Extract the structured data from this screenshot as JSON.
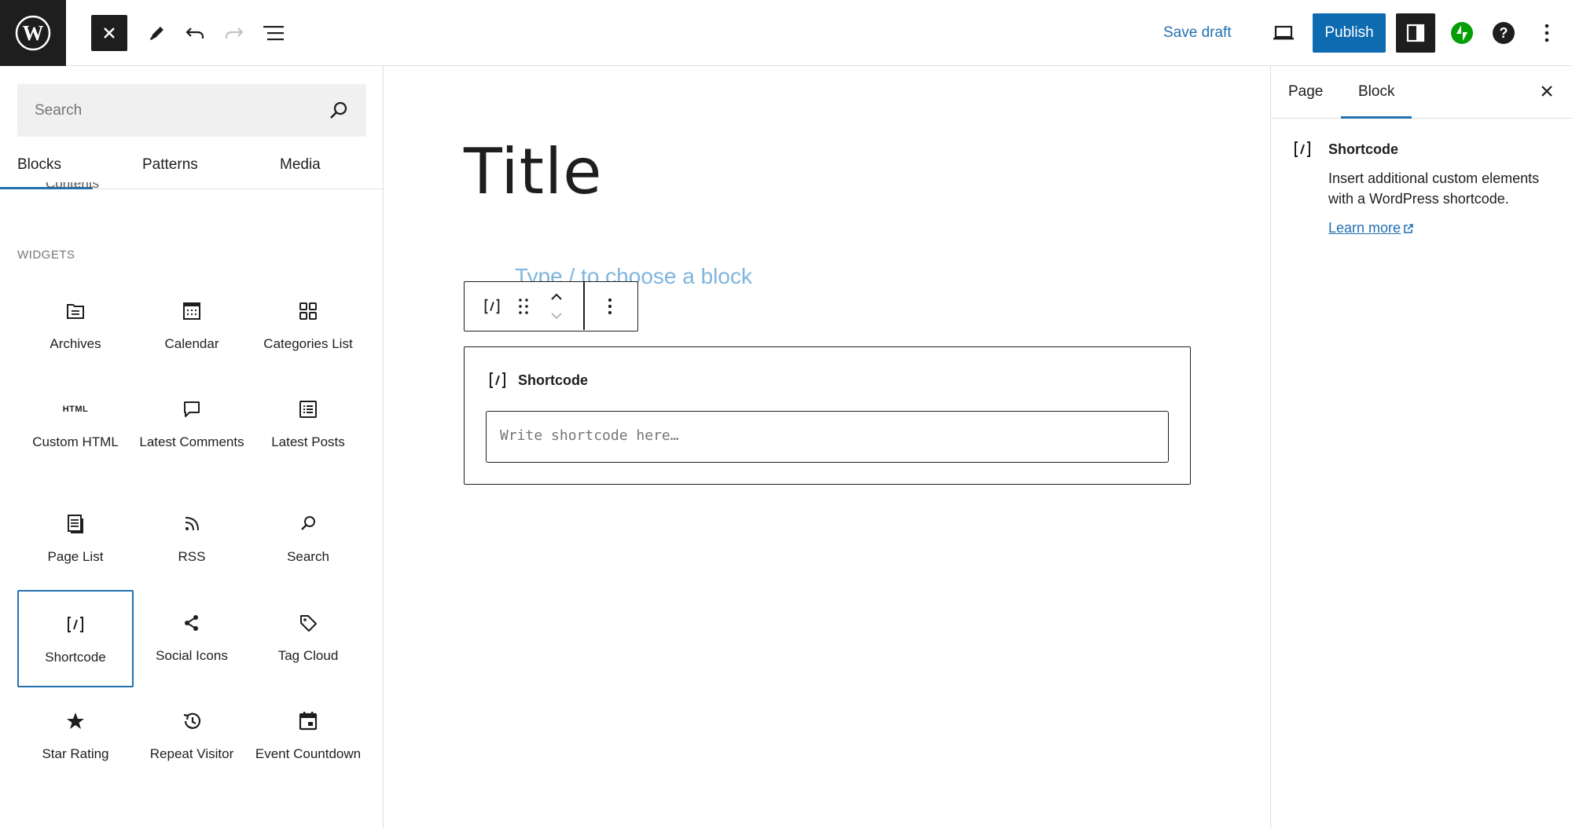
{
  "topbar": {
    "save_draft_label": "Save draft",
    "publish_label": "Publish"
  },
  "inserter": {
    "search_placeholder": "Search",
    "tabs": [
      {
        "label": "Blocks",
        "active": true
      },
      {
        "label": "Patterns",
        "active": false
      },
      {
        "label": "Media",
        "active": false
      }
    ],
    "cut_off_label": "Contents",
    "section_label": "WIDGETS",
    "items": [
      {
        "label": "Archives",
        "icon": "archive-icon"
      },
      {
        "label": "Calendar",
        "icon": "calendar-icon"
      },
      {
        "label": "Categories List",
        "icon": "categories-icon"
      },
      {
        "label": "Custom HTML",
        "icon": "html-icon",
        "icon_text": "HTML"
      },
      {
        "label": "Latest Comments",
        "icon": "comment-icon"
      },
      {
        "label": "Latest Posts",
        "icon": "latest-posts-icon"
      },
      {
        "label": "Page List",
        "icon": "page-list-icon"
      },
      {
        "label": "RSS",
        "icon": "rss-icon"
      },
      {
        "label": "Search",
        "icon": "search-icon"
      },
      {
        "label": "Shortcode",
        "icon": "shortcode-icon",
        "selected": true
      },
      {
        "label": "Social Icons",
        "icon": "share-icon"
      },
      {
        "label": "Tag Cloud",
        "icon": "tag-icon"
      },
      {
        "label": "Star Rating",
        "icon": "star-icon"
      },
      {
        "label": "Repeat Visitor",
        "icon": "history-icon"
      },
      {
        "label": "Event Countdown",
        "icon": "event-icon"
      }
    ]
  },
  "canvas": {
    "title": "Title",
    "appender_text": "Type / to choose a block",
    "shortcode_block": {
      "title": "Shortcode",
      "input_placeholder": "Write shortcode here…"
    }
  },
  "sidebar": {
    "tabs": [
      {
        "label": "Page",
        "active": false
      },
      {
        "label": "Block",
        "active": true
      }
    ],
    "block_card": {
      "name": "Shortcode",
      "description": "Insert additional custom elements with a WordPress shortcode.",
      "learn_more": "Learn more"
    }
  },
  "colors": {
    "accent": "#2271b1",
    "publish_bg": "#0e6bb0",
    "dark": "#1e1e1e",
    "jetpack_green": "#069e08"
  }
}
